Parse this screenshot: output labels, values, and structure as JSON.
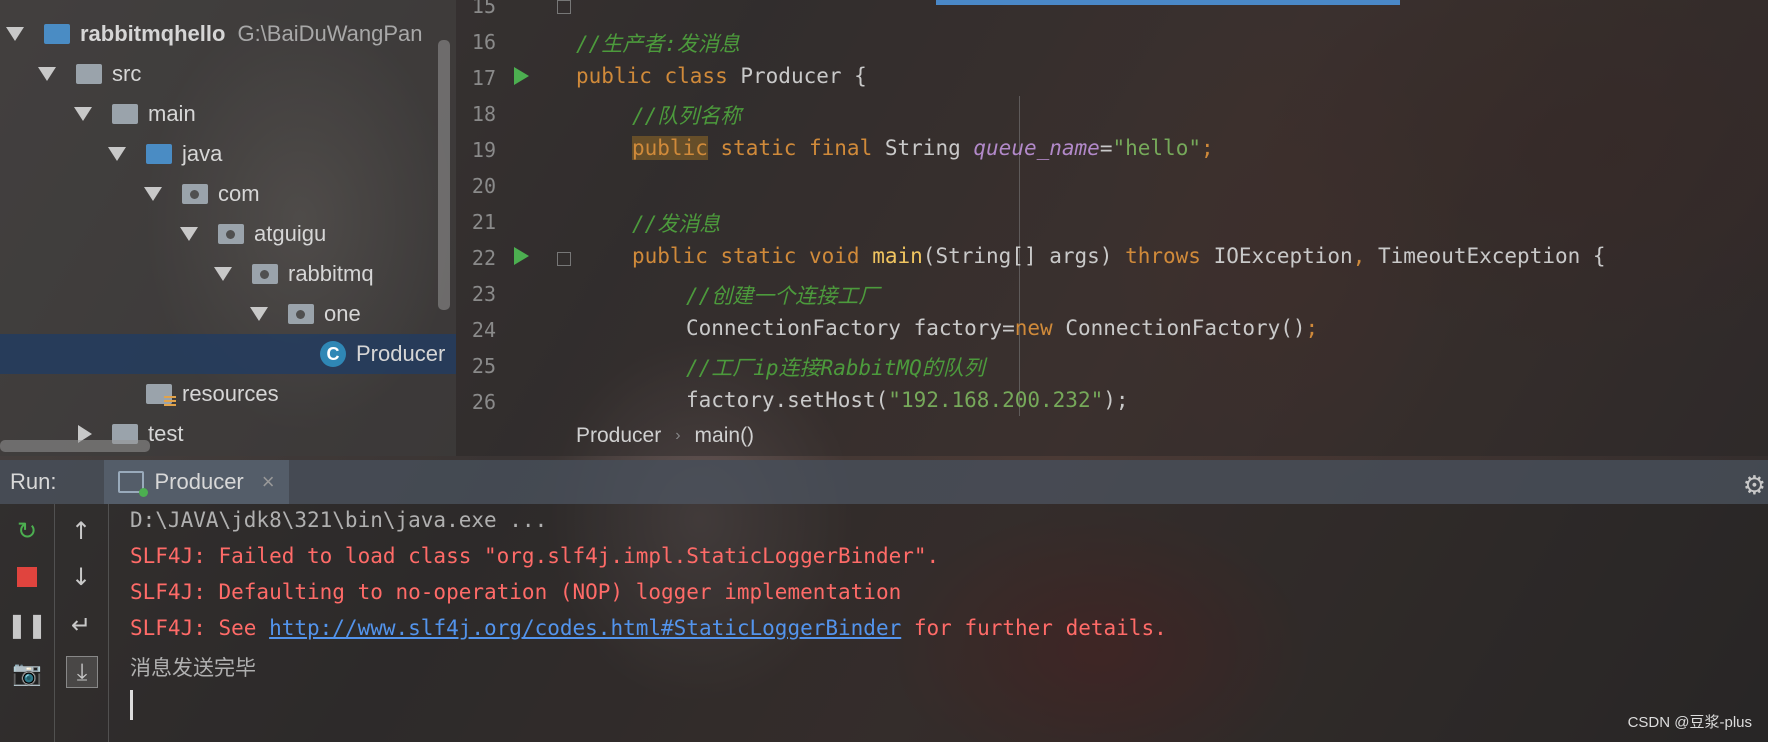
{
  "tree": {
    "project": "rabbitmqhello",
    "project_path": "G:\\BaiDuWangPan",
    "items": [
      "src",
      "main",
      "java",
      "com",
      "atguigu",
      "rabbitmq",
      "one",
      "Producer",
      "resources",
      "test"
    ]
  },
  "editor": {
    "line_numbers": [
      "15",
      "16",
      "17",
      "18",
      "19",
      "20",
      "21",
      "22",
      "23",
      "24",
      "25",
      "26"
    ],
    "lines": {
      "l16": "//生产者:发消息",
      "l18": "//队列名称",
      "l19_kw1": "public",
      "l19_kw2": " static final ",
      "l19_type": "String ",
      "l19_field": "queue_name",
      "l19_eq": "=",
      "l19_str": "\"hello\"",
      "l19_end": ";",
      "l21": "//发消息",
      "l23": "//创建一个连接工厂",
      "l25": "//工厂ip连接RabbitMQ的队列",
      "l26_a": "factory.setHost(",
      "l26_str": "\"192.168.200.232\"",
      "l26_b": ");"
    },
    "breadcrumb": [
      "Producer",
      "main()"
    ]
  },
  "run": {
    "label": "Run:",
    "tab": "Producer",
    "close": "×",
    "console": [
      "D:\\JAVA\\jdk8\\321\\bin\\java.exe ...",
      "SLF4J: Failed to load class \"org.slf4j.impl.StaticLoggerBinder\".",
      "SLF4J: Defaulting to no-operation (NOP) logger implementation",
      "SLF4J: See ",
      "http://www.slf4j.org/codes.html#StaticLoggerBinder",
      " for further details.",
      "消息发送完毕"
    ]
  },
  "watermark": "CSDN @豆浆-plus",
  "colors": {
    "keyword": "#d08a3a",
    "comment": "#4c9a3c",
    "string": "#76a95a",
    "error": "#ff6b68",
    "link": "#5394ec"
  }
}
